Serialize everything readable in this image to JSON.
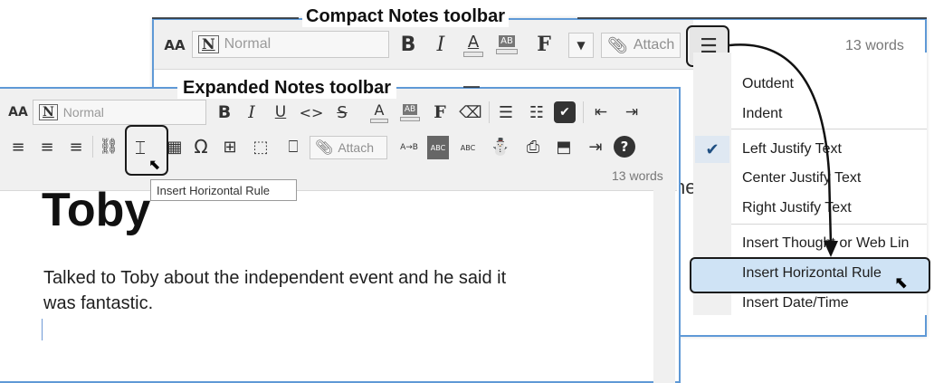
{
  "callouts": {
    "compact": "Compact Notes toolbar",
    "expanded": "Expanded Notes toolbar"
  },
  "compact_toolbar": {
    "font_size_glyph": "AA",
    "style_value": "Normal",
    "style_glyph": "N",
    "bold": "B",
    "italic": "I",
    "color": "A",
    "highlight": "AB",
    "font": "F",
    "attach_label": "Attach",
    "word_count": "13 words"
  },
  "menu": {
    "items": [
      "Outdent",
      "Indent",
      "Left Justify Text",
      "Center Justify Text",
      "Right Justify Text",
      "Insert Thought or Web Lin",
      "Insert Horizontal Rule",
      "Insert Date/Time"
    ],
    "checked_item": "Left Justify Text",
    "selected_item": "Insert Horizontal Rule"
  },
  "expanded_toolbar": {
    "font_size_glyph": "AA",
    "style_value": "Normal",
    "style_glyph": "N",
    "bold": "B",
    "italic": "I",
    "underline": "U",
    "strike": "S",
    "color": "A",
    "highlight": "AB",
    "font": "F",
    "attach_label": "Attach",
    "word_count": "13 words",
    "spell_label_a": "ABC",
    "spell_label_b": "ABC",
    "replace_label": "A→B"
  },
  "tooltip": "Insert Horizontal Rule",
  "document": {
    "title": "Toby",
    "body_line1": "Talked to Toby about the independent event and he said it",
    "body_line2": "was fantastic.",
    "partial_glyph": "ne"
  },
  "colors": {
    "window_border": "#5f99d6",
    "toolbar_bg": "#f0f0f0",
    "menu_highlight": "#cfe3f5",
    "check": "#1f4f82"
  }
}
